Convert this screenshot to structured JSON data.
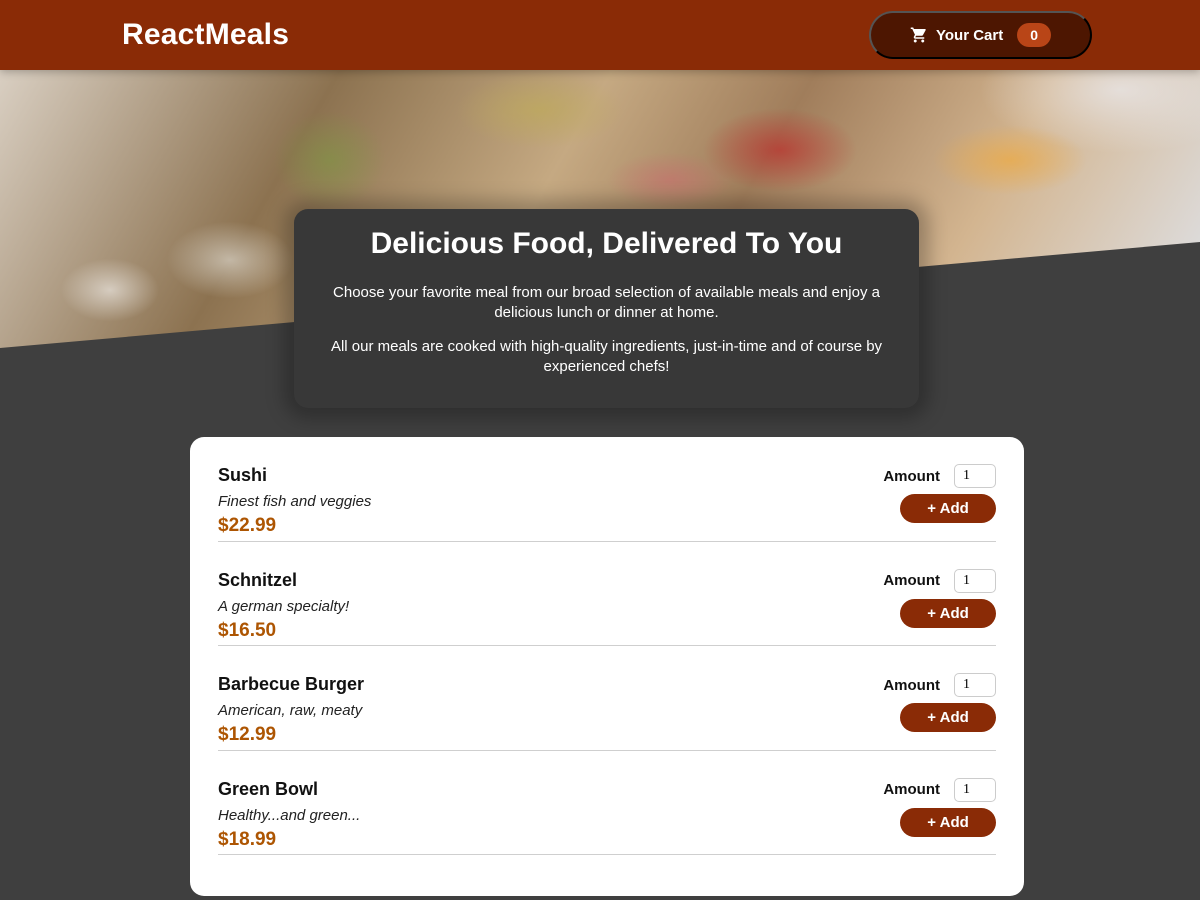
{
  "header": {
    "logo": "ReactMeals",
    "cart": {
      "icon": "cart-icon",
      "label": "Your Cart",
      "count": "0"
    }
  },
  "summary": {
    "title": "Delicious Food, Delivered To You",
    "paragraph_1": "Choose your favorite meal from our broad selection of available meals and enjoy a delicious lunch or dinner at home.",
    "paragraph_2": "All our meals are cooked with high-quality ingredients, just-in-time and of course by experienced chefs!"
  },
  "meals": [
    {
      "name": "Sushi",
      "description": "Finest fish and veggies",
      "price": "$22.99",
      "amount_label": "Amount",
      "amount": "1",
      "add_label": "+ Add"
    },
    {
      "name": "Schnitzel",
      "description": "A german specialty!",
      "price": "$16.50",
      "amount_label": "Amount",
      "amount": "1",
      "add_label": "+ Add"
    },
    {
      "name": "Barbecue Burger",
      "description": "American, raw, meaty",
      "price": "$12.99",
      "amount_label": "Amount",
      "amount": "1",
      "add_label": "+ Add"
    },
    {
      "name": "Green Bowl",
      "description": "Healthy...and green...",
      "price": "$18.99",
      "amount_label": "Amount",
      "amount": "1",
      "add_label": "+ Add"
    }
  ],
  "colors": {
    "header": "#8a2b06",
    "cart_button": "#4d1601",
    "badge": "#b94517",
    "background": "#3f3f3f",
    "summary": "#383838",
    "price": "#ad5502"
  }
}
